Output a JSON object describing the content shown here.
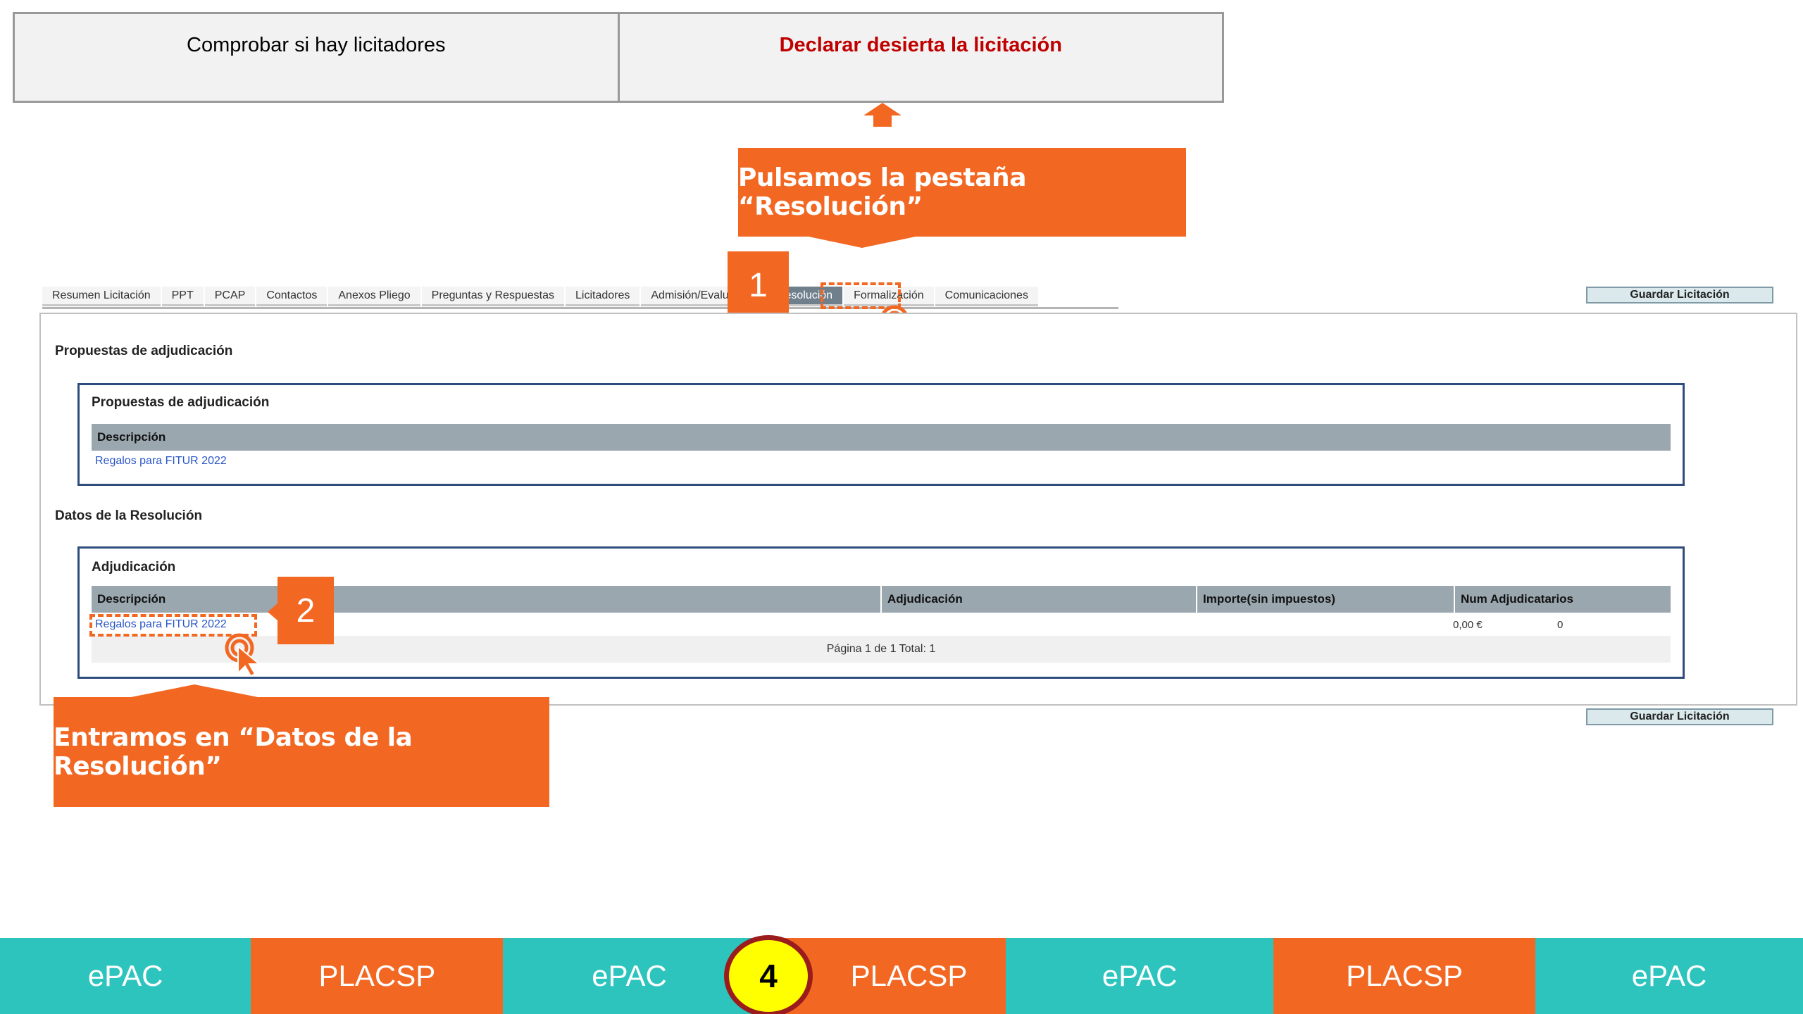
{
  "top_table": {
    "left": "Comprobar si hay licitadores",
    "right": "Declarar desierta la licitación"
  },
  "callouts": {
    "top": "Pulsamos la pestaña “Resolución”",
    "bottom": "Entramos en “Datos de la Resolución”"
  },
  "steps": {
    "one": "1",
    "two": "2",
    "bottom": "4"
  },
  "tabs": [
    {
      "label": "Resumen Licitación"
    },
    {
      "label": "PPT"
    },
    {
      "label": "PCAP"
    },
    {
      "label": "Contactos"
    },
    {
      "label": "Anexos Pliego"
    },
    {
      "label": "Preguntas y Respuestas"
    },
    {
      "label": "Licitadores"
    },
    {
      "label": "Admisión/Evaluación"
    },
    {
      "label": "Resolución"
    },
    {
      "label": "Formalización"
    },
    {
      "label": "Comunicaciones"
    }
  ],
  "save_button": "Guardar Licitación",
  "proposals": {
    "section_title": "Propuestas de adjudicación",
    "box_title": "Propuestas de adjudicación",
    "col_description": "Descripción",
    "row_link": "Regalos para FITUR 2022"
  },
  "resolution": {
    "section_title": "Datos de la Resolución",
    "box_title": "Adjudicación",
    "col_description": "Descripción",
    "col_adjudication": "Adjudicación",
    "col_amount": "Importe(sin impuestos)",
    "col_awardees": "Num Adjudicatarios",
    "row_link": "Regalos para FITUR 2022",
    "row_amount": "0,00 €",
    "row_awardees": "0",
    "pager": "Página 1 de 1     Total: 1"
  },
  "bottom_bar": [
    "ePAC",
    "PLACSP",
    "ePAC",
    "PLACSP",
    "ePAC",
    "PLACSP",
    "ePAC"
  ],
  "colors": {
    "accent_orange": "#f26722",
    "teal": "#2ec4be",
    "header_red": "#c00000",
    "box_border": "#2e4c7c",
    "grid_header": "#9aa7af"
  }
}
